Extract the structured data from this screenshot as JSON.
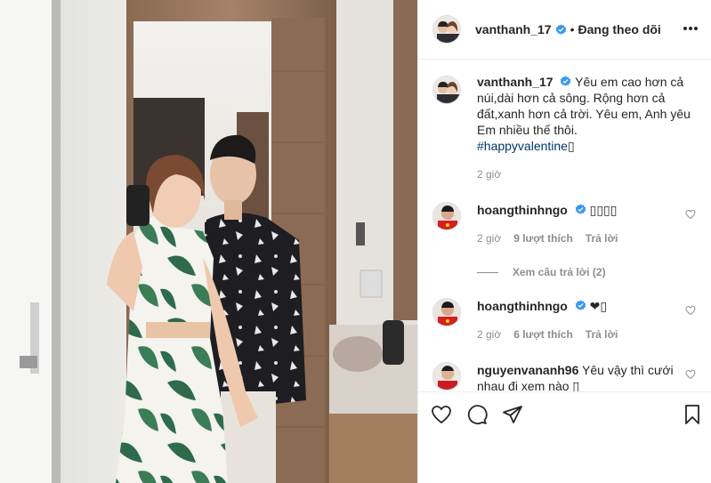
{
  "post": {
    "author": "vanthanh_17",
    "follow_status": "Đang theo dõi",
    "separator": "•",
    "caption_text": "Yêu em cao hơn cả núi,dài hơn cả sông. Rộng hơn cả đất,xanh hơn cả trời. Yêu em, Anh yêu Em nhiều thế thôi.",
    "hashtag": "#happyvalentine",
    "hashtag_tail": "▯",
    "time": "2 giờ"
  },
  "comments": [
    {
      "username": "hoangthinhngo",
      "text": "▯▯▯▯",
      "time": "2 giờ",
      "likes": "9 lượt thích",
      "reply_label": "Trả lời",
      "view_replies": "Xem câu trả lời (2)"
    },
    {
      "username": "hoangthinhngo",
      "text": "❤▯",
      "time": "2 giờ",
      "likes": "6 lượt thích",
      "reply_label": "Trả lời"
    },
    {
      "username": "nguyenvananh96",
      "text": "Yêu vậy thì cưới nhau đi xem nào ▯"
    }
  ],
  "icons": {
    "like": "heart-icon",
    "comment": "comment-icon",
    "share": "share-icon",
    "save": "bookmark-icon",
    "verified": "verified-badge-icon",
    "more": "more-options-icon"
  },
  "colors": {
    "verified_blue": "#3897f0",
    "text": "#262626",
    "secondary": "#8e8e8e",
    "hashtag": "#00376b",
    "border": "#efefef"
  }
}
